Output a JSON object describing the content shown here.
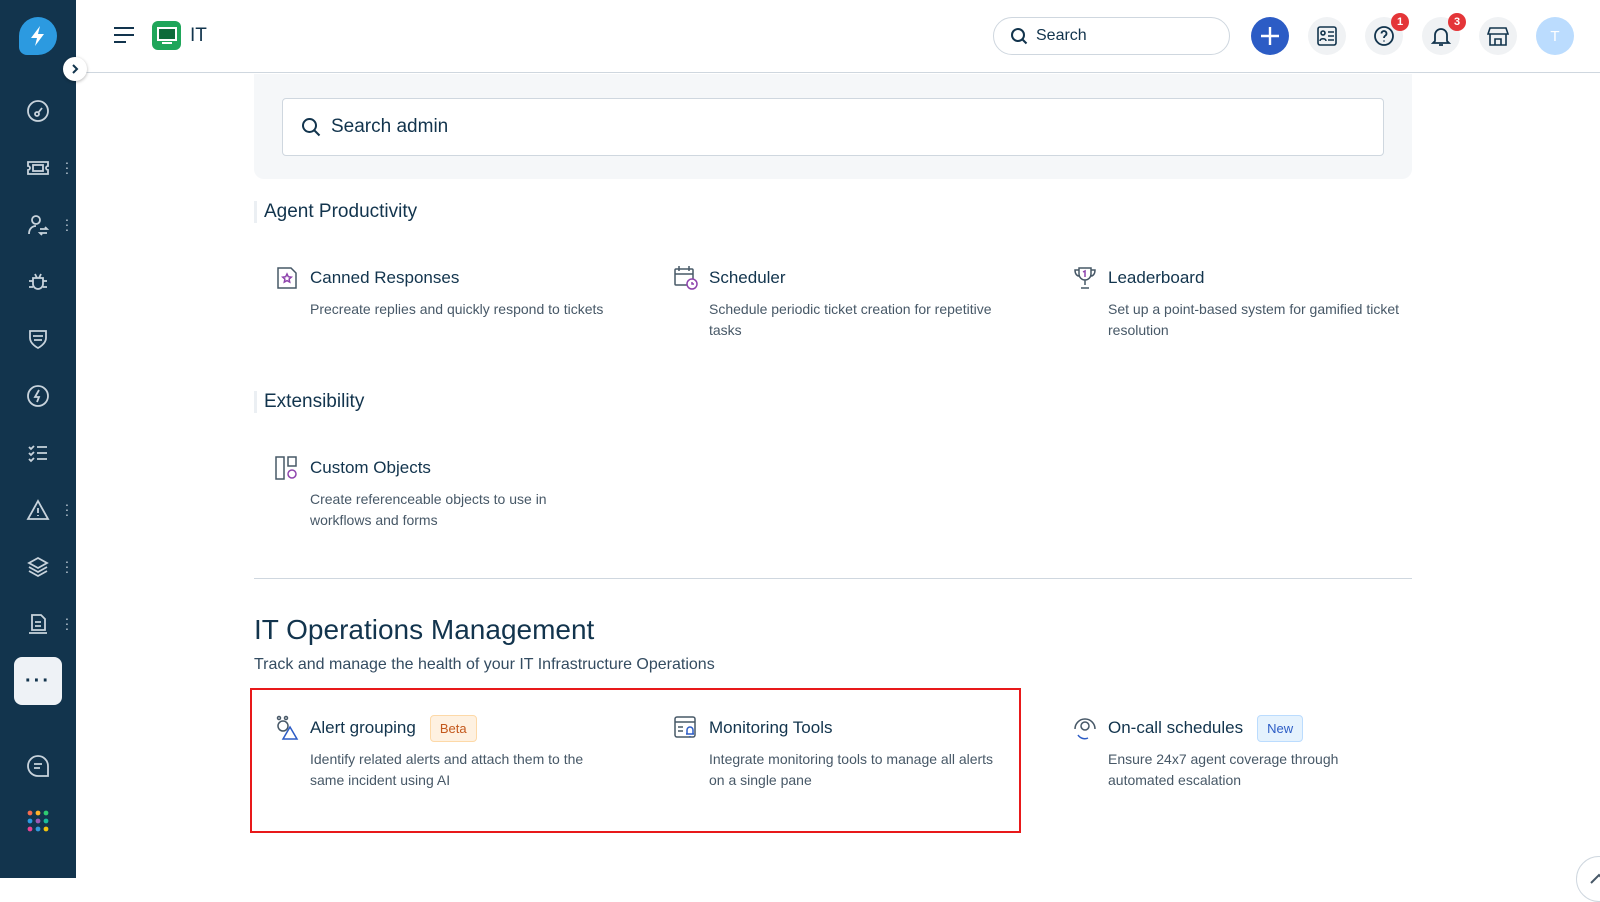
{
  "header": {
    "workspace": "IT",
    "search_placeholder": "Search",
    "help_badge": "1",
    "notif_badge": "3",
    "avatar_initial": "T"
  },
  "admin_search": {
    "placeholder": "Search admin"
  },
  "sections": [
    {
      "title": "Agent Productivity",
      "items": [
        {
          "title": "Canned Responses",
          "desc": "Precreate replies and quickly respond to tickets",
          "icon": "canned-responses-icon"
        },
        {
          "title": "Scheduler",
          "desc": "Schedule periodic ticket creation for repetitive tasks",
          "icon": "scheduler-icon"
        },
        {
          "title": "Leaderboard",
          "desc": "Set up a point-based system for gamified ticket resolution",
          "icon": "trophy-icon"
        }
      ]
    },
    {
      "title": "Extensibility",
      "items": [
        {
          "title": "Custom Objects",
          "desc": "Create referenceable objects to use in workflows and forms",
          "icon": "custom-objects-icon"
        }
      ]
    }
  ],
  "itom": {
    "title": "IT Operations Management",
    "subtitle": "Track and manage the health of your IT Infrastructure Operations",
    "items": [
      {
        "title": "Alert grouping",
        "tag": "Beta",
        "desc": "Identify related alerts and attach them to the same incident using AI"
      },
      {
        "title": "Monitoring Tools",
        "desc": "Integrate monitoring tools to manage all alerts on a single pane"
      },
      {
        "title": "On-call schedules",
        "tag": "New",
        "desc": "Ensure 24x7 agent coverage through automated escalation"
      }
    ]
  },
  "colors": {
    "sidebar": "#12344d",
    "accent": "#2c5cc5",
    "highlight": "#e8191a",
    "badge": "#e43538"
  }
}
